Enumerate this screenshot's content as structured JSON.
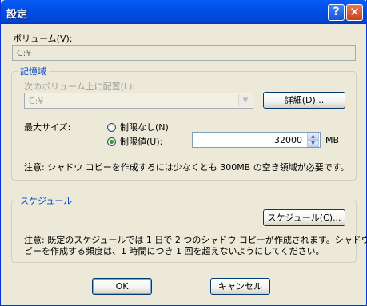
{
  "window": {
    "title": "設定"
  },
  "titlebar": {
    "help_glyph": "?",
    "close_glyph": "✕"
  },
  "volume": {
    "label": "ボリューム(V):",
    "value": "C:¥"
  },
  "storage_group": {
    "title": "記憶域",
    "location_label": "次のボリューム上に配置(L):",
    "location_value": "C:¥",
    "details_button": "詳細(D)...",
    "max_size_label": "最大サイズ:",
    "unlimited_option": "制限なし(N)",
    "limit_option": "制限値(U):",
    "limit_value": "32000",
    "unit": "MB",
    "note": "注意: シャドウ コピーを作成するには少なくとも 300MB の空き領域が必要です。",
    "selected_option": "limit"
  },
  "schedule_group": {
    "title": "スケジュール",
    "schedule_button": "スケジュール(C)...",
    "note_line1": "注意: 既定のスケジュールでは 1 日で 2 つのシャドウ コピーが作成されます。シャドウ コ",
    "note_line2": "ピーを作成する頻度は、1 時間につき 1 回を超えないようにしてください。"
  },
  "footer": {
    "ok_button": "OK",
    "cancel_button": "キャンセル"
  }
}
